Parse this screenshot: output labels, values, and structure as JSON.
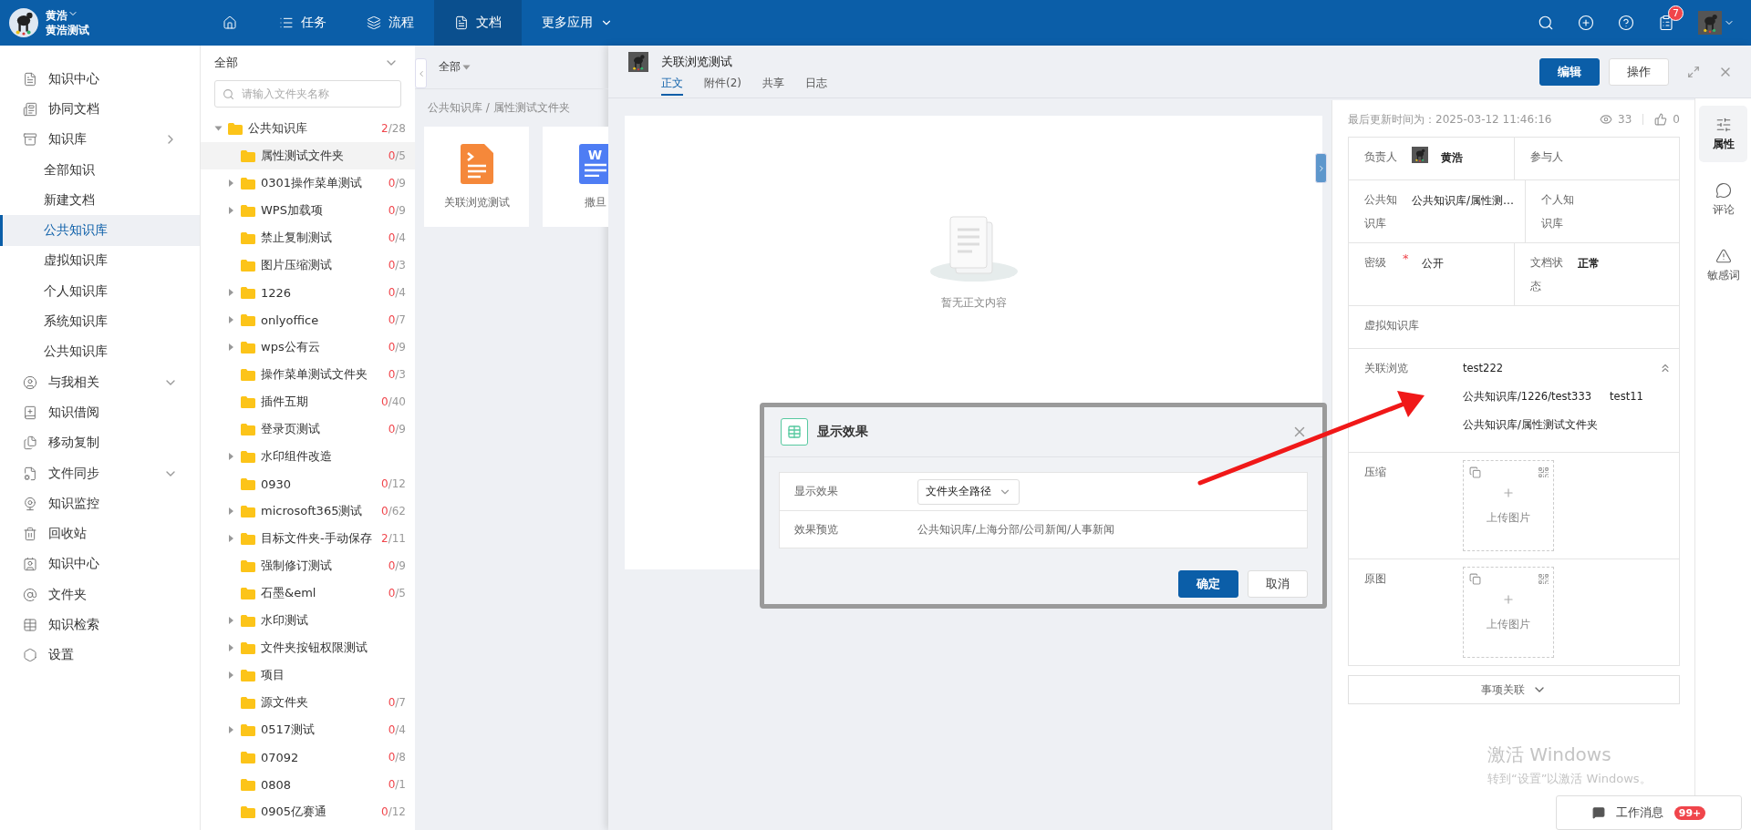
{
  "user": {
    "name": "黄浩",
    "org": "黄浩测试"
  },
  "nav": [
    {
      "kind": "home",
      "selected": false
    },
    {
      "kind": "list",
      "label": "任务",
      "selected": false
    },
    {
      "kind": "layers",
      "label": "流程",
      "selected": false
    },
    {
      "kind": "doc",
      "label": "文档",
      "selected": true
    },
    {
      "kind": "more",
      "label": "更多应用",
      "selected": false
    }
  ],
  "header_actions": [
    {
      "kind": "search"
    },
    {
      "kind": "add"
    },
    {
      "kind": "help"
    },
    {
      "kind": "todo",
      "badge": "7"
    }
  ],
  "sidebar": {
    "items": [
      {
        "kind": "doc",
        "label": "知识中心",
        "selected": false
      },
      {
        "kind": "card",
        "label": "协同文档",
        "selected": false
      },
      {
        "kind": "archive",
        "label": "知识库",
        "selected": false,
        "expanded": true,
        "children": [
          {
            "label": "全部知识",
            "selected": false
          },
          {
            "label": "新建文档",
            "selected": false
          },
          {
            "label": "公共知识库",
            "selected": true
          },
          {
            "label": "虚拟知识库",
            "selected": false
          },
          {
            "label": "个人知识库",
            "selected": false
          },
          {
            "label": "系统知识库",
            "selected": false
          },
          {
            "label": "公共知识库",
            "selected": false
          }
        ]
      },
      {
        "kind": "user",
        "label": "与我相关",
        "selected": false,
        "expanded": false
      },
      {
        "kind": "book",
        "label": "知识借阅",
        "selected": false
      },
      {
        "kind": "copy",
        "label": "移动复制",
        "selected": false
      },
      {
        "kind": "sync",
        "label": "文件同步",
        "selected": false,
        "expanded": false
      },
      {
        "kind": "camera",
        "label": "知识监控",
        "selected": false
      },
      {
        "kind": "trash",
        "label": "回收站",
        "selected": false
      },
      {
        "kind": "contact",
        "label": "知识中心",
        "selected": false
      },
      {
        "kind": "at",
        "label": "文件夹",
        "selected": false
      },
      {
        "kind": "table",
        "label": "知识检索",
        "selected": false
      },
      {
        "kind": "hex",
        "label": "设置",
        "selected": false
      }
    ]
  },
  "tree": {
    "scope": "全部",
    "search_placeholder": "请输入文件夹名称",
    "root": {
      "label": "公共知识库",
      "expanded": true,
      "selected": false,
      "unread": "2",
      "total": "/28",
      "children": [
        {
          "label": "属性测试文件夹",
          "expandable": false,
          "selected": true,
          "unread": "0",
          "total": "/5"
        },
        {
          "label": "0301操作菜单测试",
          "expandable": true,
          "selected": false,
          "unread": "0",
          "total": "/9"
        },
        {
          "label": "WPS加载项",
          "expandable": true,
          "selected": false,
          "unread": "0",
          "total": "/9"
        },
        {
          "label": "禁止复制测试",
          "expandable": false,
          "selected": false,
          "unread": "0",
          "total": "/4"
        },
        {
          "label": "图片压缩测试",
          "expandable": false,
          "selected": false,
          "unread": "0",
          "total": "/3"
        },
        {
          "label": "1226",
          "expandable": true,
          "selected": false,
          "unread": "0",
          "total": "/4"
        },
        {
          "label": "onlyoffice",
          "expandable": true,
          "selected": false,
          "unread": "0",
          "total": "/7"
        },
        {
          "label": "wps公有云",
          "expandable": true,
          "selected": false,
          "unread": "0",
          "total": "/9"
        },
        {
          "label": "操作菜单测试文件夹",
          "expandable": false,
          "selected": false,
          "unread": "0",
          "total": "/3"
        },
        {
          "label": "插件五期",
          "expandable": false,
          "selected": false,
          "unread": "0",
          "total": "/40"
        },
        {
          "label": "登录页测试",
          "expandable": false,
          "selected": false,
          "unread": "0",
          "total": "/9"
        },
        {
          "label": "水印组件改造",
          "expandable": true,
          "selected": false
        },
        {
          "label": "0930",
          "expandable": false,
          "selected": false,
          "unread": "0",
          "total": "/12"
        },
        {
          "label": "microsoft365测试",
          "expandable": true,
          "selected": false,
          "unread": "0",
          "total": "/62"
        },
        {
          "label": "目标文件夹-手动保存",
          "expandable": true,
          "selected": false,
          "unread": "2",
          "total": "/11"
        },
        {
          "label": "强制修订测试",
          "expandable": false,
          "selected": false,
          "unread": "0",
          "total": "/9"
        },
        {
          "label": "石墨&eml",
          "expandable": false,
          "selected": false,
          "unread": "0",
          "total": "/5"
        },
        {
          "label": "水印测试",
          "expandable": true,
          "selected": false
        },
        {
          "label": "文件夹按钮权限测试",
          "expandable": true,
          "selected": false
        },
        {
          "label": "项目",
          "expandable": true,
          "selected": false
        },
        {
          "label": "源文件夹",
          "expandable": false,
          "selected": false,
          "unread": "0",
          "total": "/7"
        },
        {
          "label": "0517测试",
          "expandable": true,
          "selected": false,
          "unread": "0",
          "total": "/4"
        },
        {
          "label": "07092",
          "expandable": false,
          "selected": false,
          "unread": "0",
          "total": "/8"
        },
        {
          "label": "0808",
          "expandable": false,
          "selected": false,
          "unread": "0",
          "total": "/1"
        },
        {
          "label": "0905亿赛通",
          "expandable": false,
          "selected": false,
          "unread": "0",
          "total": "/12"
        }
      ]
    }
  },
  "folder_view": {
    "scope": "全部",
    "breadcrumb": "公共知识库 / 属性测试文件夹",
    "files": [
      {
        "name": "关联浏览测试",
        "kind": "text"
      },
      {
        "name": "撒旦",
        "kind": "word",
        "icon_letter": "W"
      }
    ]
  },
  "document": {
    "title": "关联浏览测试",
    "tabs": [
      {
        "label": "正文",
        "selected": true
      },
      {
        "label": "附件(2)",
        "selected": false
      },
      {
        "label": "共享",
        "selected": false
      },
      {
        "label": "日志",
        "selected": false
      }
    ],
    "actions": [
      {
        "label": "编辑",
        "kind": "primary"
      },
      {
        "label": "操作",
        "kind": "default"
      }
    ],
    "empty_text": "暂无正文内容"
  },
  "properties": {
    "updated": "最后更新时间为：2025-03-12 11:46:16",
    "views": "33",
    "likes": "0",
    "rows": [
      {
        "cells": [
          {
            "kind": "person",
            "label": "负责人",
            "value": "黄浩"
          },
          {
            "kind": "text",
            "label": "参与人"
          }
        ]
      },
      {
        "cells": [
          {
            "kind": "text",
            "label": "公共知识库",
            "value": "公共知识库/属性测…"
          },
          {
            "kind": "text",
            "label": "个人知识库"
          }
        ]
      },
      {
        "cells": [
          {
            "kind": "required",
            "label": "密级",
            "mark": "*",
            "value": "公开"
          },
          {
            "kind": "text",
            "label": "文档状态",
            "value": "正常"
          }
        ]
      },
      {
        "cells": [
          {
            "kind": "text",
            "label": "虚拟知识库"
          }
        ]
      },
      {
        "cells": [
          {
            "kind": "links",
            "label": "关联浏览",
            "expanded": true,
            "values": [
              "test222",
              "公共知识库/1226/test333",
              "test11",
              "公共知识库/属性测试文件夹"
            ]
          }
        ]
      },
      {
        "cells": [
          {
            "kind": "upload",
            "label": "压缩",
            "hint": "上传图片"
          }
        ]
      },
      {
        "cells": [
          {
            "kind": "upload",
            "label": "原图",
            "hint": "上传图片"
          }
        ]
      }
    ],
    "related_button": "事项关联"
  },
  "side_tabs": [
    {
      "kind": "sliders",
      "label": "属性",
      "selected": true
    },
    {
      "kind": "comment",
      "label": "评论",
      "selected": false
    },
    {
      "kind": "alert",
      "label": "敏感词",
      "selected": false
    }
  ],
  "dialog": {
    "title": "显示效果",
    "rows": [
      {
        "kind": "select",
        "label": "显示效果",
        "value": "文件夹全路径"
      },
      {
        "kind": "text",
        "label": "效果预览",
        "value": "公共知识库/上海分部/公司新闻/人事新闻"
      }
    ],
    "buttons": [
      {
        "label": "确定",
        "kind": "primary"
      },
      {
        "label": "取消",
        "kind": "default"
      }
    ]
  },
  "work_messages": {
    "label": "工作消息",
    "badge": "99+"
  },
  "os_notice": {
    "title": "激活 Windows",
    "hint": "转到“设置”以激活 Windows。"
  }
}
